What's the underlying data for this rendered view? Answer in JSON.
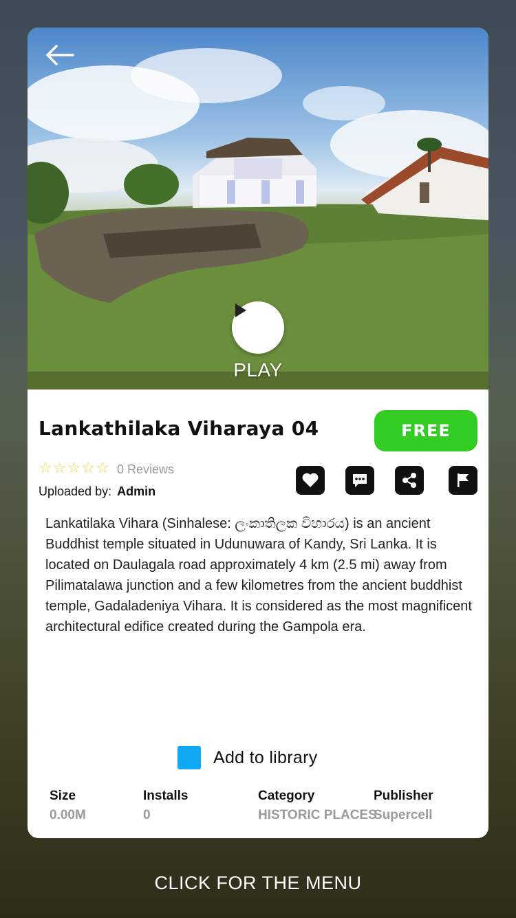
{
  "hero": {
    "play_label": "PLAY"
  },
  "item": {
    "title": "Lankathilaka Viharaya 04",
    "price_label": "FREE",
    "rating": 0,
    "rating_max": 5,
    "reviews_label": "0 Reviews",
    "uploaded_by_label": "Uploaded by:",
    "uploader": "Admin",
    "description": "Lankatilaka Vihara (Sinhalese: ලංකාතිලක විහාරය) is an ancient Buddhist temple situated in Udunuwara of Kandy, Sri Lanka. It is located on Daulagala road approximately 4 km (2.5 mi) away from Pilimatalawa junction and a few kilometres from the ancient buddhist temple, Gadaladeniya Vihara. It is considered as the most magnificent architectural edifice created during the Gampola era."
  },
  "actions": [
    {
      "icon": "heart-icon"
    },
    {
      "icon": "comment-icon"
    },
    {
      "icon": "share-icon"
    },
    {
      "icon": "flag-icon"
    }
  ],
  "library": {
    "label": "Add to library",
    "checked": true
  },
  "stats": {
    "size": {
      "label": "Size",
      "value": "0.00M"
    },
    "installs": {
      "label": "Installs",
      "value": "0"
    },
    "category": {
      "label": "Category",
      "value": "HISTORIC PLACES"
    },
    "publisher": {
      "label": "Publisher",
      "value": "Supercell"
    }
  },
  "footer": {
    "menu_label": "CLICK FOR THE MENU"
  },
  "colors": {
    "free": "#33cc22",
    "checkbox": "#10a8f5",
    "star": "#f2d23a"
  }
}
